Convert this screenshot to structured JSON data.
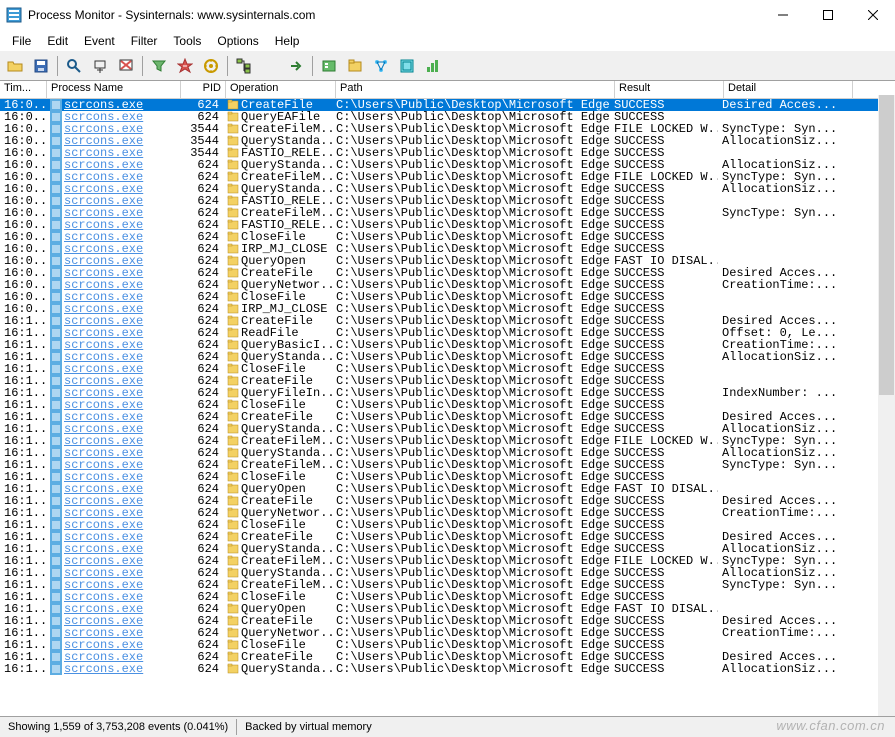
{
  "window": {
    "title": "Process Monitor - Sysinternals: www.sysinternals.com"
  },
  "menu": {
    "file": "File",
    "edit": "Edit",
    "event": "Event",
    "filter": "Filter",
    "tools": "Tools",
    "options": "Options",
    "help": "Help"
  },
  "columns": {
    "time": "Tim...",
    "process": "Process Name",
    "pid": "PID",
    "operation": "Operation",
    "path": "Path",
    "result": "Result",
    "detail": "Detail"
  },
  "path_common": "C:\\Users\\Public\\Desktop\\Microsoft Edge.lnk",
  "process_common": "scrcons.exe",
  "events": [
    {
      "t": "16:0...",
      "pid": 624,
      "op": "CreateFile",
      "res": "SUCCESS",
      "det": "Desired Acces...",
      "sel": true
    },
    {
      "t": "16:0...",
      "pid": 624,
      "op": "QueryEAFile",
      "res": "SUCCESS",
      "det": ""
    },
    {
      "t": "16:0...",
      "pid": 3544,
      "op": "CreateFileM...",
      "res": "FILE LOCKED W...",
      "det": "SyncType: Syn..."
    },
    {
      "t": "16:0...",
      "pid": 3544,
      "op": "QueryStanda...",
      "res": "SUCCESS",
      "det": "AllocationSiz..."
    },
    {
      "t": "16:0...",
      "pid": 3544,
      "op": "FASTIO_RELE...",
      "res": "SUCCESS",
      "det": ""
    },
    {
      "t": "16:0...",
      "pid": 624,
      "op": "QueryStanda...",
      "res": "SUCCESS",
      "det": "AllocationSiz..."
    },
    {
      "t": "16:0...",
      "pid": 624,
      "op": "CreateFileM...",
      "res": "FILE LOCKED W...",
      "det": "SyncType: Syn..."
    },
    {
      "t": "16:0...",
      "pid": 624,
      "op": "QueryStanda...",
      "res": "SUCCESS",
      "det": "AllocationSiz..."
    },
    {
      "t": "16:0...",
      "pid": 624,
      "op": "FASTIO_RELE...",
      "res": "SUCCESS",
      "det": ""
    },
    {
      "t": "16:0...",
      "pid": 624,
      "op": "CreateFileM...",
      "res": "SUCCESS",
      "det": "SyncType: Syn..."
    },
    {
      "t": "16:0...",
      "pid": 624,
      "op": "FASTIO_RELE...",
      "res": "SUCCESS",
      "det": ""
    },
    {
      "t": "16:0...",
      "pid": 624,
      "op": "CloseFile",
      "res": "SUCCESS",
      "det": ""
    },
    {
      "t": "16:0...",
      "pid": 624,
      "op": "IRP_MJ_CLOSE",
      "res": "SUCCESS",
      "det": ""
    },
    {
      "t": "16:0...",
      "pid": 624,
      "op": "QueryOpen",
      "res": "FAST IO DISAL...",
      "det": ""
    },
    {
      "t": "16:0...",
      "pid": 624,
      "op": "CreateFile",
      "res": "SUCCESS",
      "det": "Desired Acces..."
    },
    {
      "t": "16:0...",
      "pid": 624,
      "op": "QueryNetwor...",
      "res": "SUCCESS",
      "det": "CreationTime:..."
    },
    {
      "t": "16:0...",
      "pid": 624,
      "op": "CloseFile",
      "res": "SUCCESS",
      "det": ""
    },
    {
      "t": "16:0...",
      "pid": 624,
      "op": "IRP_MJ_CLOSE",
      "res": "SUCCESS",
      "det": ""
    },
    {
      "t": "16:1...",
      "pid": 624,
      "op": "CreateFile",
      "res": "SUCCESS",
      "det": "Desired Acces..."
    },
    {
      "t": "16:1...",
      "pid": 624,
      "op": "ReadFile",
      "res": "SUCCESS",
      "det": "Offset: 0, Le..."
    },
    {
      "t": "16:1...",
      "pid": 624,
      "op": "QueryBasicI...",
      "res": "SUCCESS",
      "det": "CreationTime:..."
    },
    {
      "t": "16:1...",
      "pid": 624,
      "op": "QueryStanda...",
      "res": "SUCCESS",
      "det": "AllocationSiz..."
    },
    {
      "t": "16:1...",
      "pid": 624,
      "op": "CloseFile",
      "res": "SUCCESS",
      "det": ""
    },
    {
      "t": "16:1...",
      "pid": 624,
      "op": "CreateFile",
      "res": "SUCCESS",
      "det": ""
    },
    {
      "t": "16:1...",
      "pid": 624,
      "op": "QueryFileIn...",
      "res": "SUCCESS",
      "det": "IndexNumber: ..."
    },
    {
      "t": "16:1...",
      "pid": 624,
      "op": "CloseFile",
      "res": "SUCCESS",
      "det": ""
    },
    {
      "t": "16:1...",
      "pid": 624,
      "op": "CreateFile",
      "res": "SUCCESS",
      "det": "Desired Acces..."
    },
    {
      "t": "16:1...",
      "pid": 624,
      "op": "QueryStanda...",
      "res": "SUCCESS",
      "det": "AllocationSiz..."
    },
    {
      "t": "16:1...",
      "pid": 624,
      "op": "CreateFileM...",
      "res": "FILE LOCKED W...",
      "det": "SyncType: Syn..."
    },
    {
      "t": "16:1...",
      "pid": 624,
      "op": "QueryStanda...",
      "res": "SUCCESS",
      "det": "AllocationSiz..."
    },
    {
      "t": "16:1...",
      "pid": 624,
      "op": "CreateFileM...",
      "res": "SUCCESS",
      "det": "SyncType: Syn..."
    },
    {
      "t": "16:1...",
      "pid": 624,
      "op": "CloseFile",
      "res": "SUCCESS",
      "det": ""
    },
    {
      "t": "16:1...",
      "pid": 624,
      "op": "QueryOpen",
      "res": "FAST IO DISAL...",
      "det": ""
    },
    {
      "t": "16:1...",
      "pid": 624,
      "op": "CreateFile",
      "res": "SUCCESS",
      "det": "Desired Acces..."
    },
    {
      "t": "16:1...",
      "pid": 624,
      "op": "QueryNetwor...",
      "res": "SUCCESS",
      "det": "CreationTime:..."
    },
    {
      "t": "16:1...",
      "pid": 624,
      "op": "CloseFile",
      "res": "SUCCESS",
      "det": ""
    },
    {
      "t": "16:1...",
      "pid": 624,
      "op": "CreateFile",
      "res": "SUCCESS",
      "det": "Desired Acces..."
    },
    {
      "t": "16:1...",
      "pid": 624,
      "op": "QueryStanda...",
      "res": "SUCCESS",
      "det": "AllocationSiz..."
    },
    {
      "t": "16:1...",
      "pid": 624,
      "op": "CreateFileM...",
      "res": "FILE LOCKED W...",
      "det": "SyncType: Syn..."
    },
    {
      "t": "16:1...",
      "pid": 624,
      "op": "QueryStanda...",
      "res": "SUCCESS",
      "det": "AllocationSiz..."
    },
    {
      "t": "16:1...",
      "pid": 624,
      "op": "CreateFileM...",
      "res": "SUCCESS",
      "det": "SyncType: Syn..."
    },
    {
      "t": "16:1...",
      "pid": 624,
      "op": "CloseFile",
      "res": "SUCCESS",
      "det": ""
    },
    {
      "t": "16:1...",
      "pid": 624,
      "op": "QueryOpen",
      "res": "FAST IO DISAL...",
      "det": ""
    },
    {
      "t": "16:1...",
      "pid": 624,
      "op": "CreateFile",
      "res": "SUCCESS",
      "det": "Desired Acces..."
    },
    {
      "t": "16:1...",
      "pid": 624,
      "op": "QueryNetwor...",
      "res": "SUCCESS",
      "det": "CreationTime:..."
    },
    {
      "t": "16:1...",
      "pid": 624,
      "op": "CloseFile",
      "res": "SUCCESS",
      "det": ""
    },
    {
      "t": "16:1...",
      "pid": 624,
      "op": "CreateFile",
      "res": "SUCCESS",
      "det": "Desired Acces..."
    },
    {
      "t": "16:1...",
      "pid": 624,
      "op": "QueryStanda...",
      "res": "SUCCESS",
      "det": "AllocationSiz..."
    }
  ],
  "status": {
    "left": "Showing 1,559 of 3,753,208 events (0.041%)",
    "right": "Backed by virtual memory"
  },
  "watermark": "www.cfan.com.cn"
}
